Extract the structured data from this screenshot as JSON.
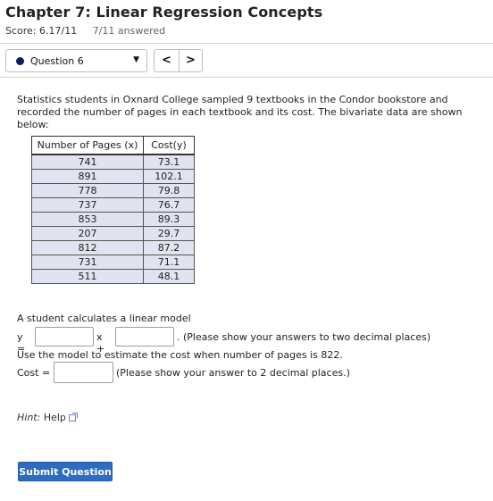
{
  "header": {
    "title": "Chapter 7: Linear Regression Concepts",
    "score": "Score: 6.17/11",
    "answered": "7/11 answered"
  },
  "question_nav": {
    "selected": "Question 6",
    "prev_label": "<",
    "next_label": ">"
  },
  "problem": {
    "text": "Statistics students in Oxnard College sampled 9 textbooks in the Condor bookstore and recorded the number of pages in each textbook and its cost. The bivariate data are shown below:",
    "table": {
      "headers": [
        "Number of Pages (x)",
        "Cost(y)"
      ],
      "rows": [
        [
          "741",
          "73.1"
        ],
        [
          "891",
          "102.1"
        ],
        [
          "778",
          "79.8"
        ],
        [
          "737",
          "76.7"
        ],
        [
          "853",
          "89.3"
        ],
        [
          "207",
          "29.7"
        ],
        [
          "812",
          "87.2"
        ],
        [
          "731",
          "71.1"
        ],
        [
          "511",
          "48.1"
        ]
      ]
    },
    "model_statement": "A student calculates a linear model",
    "y_label": "y =",
    "x_label": "x +",
    "slope_value": "",
    "intercept_value": "",
    "decimal_note": ". (Please show your answers to two decimal places)",
    "estimate_statement": "Use the model to estimate the cost when number of pages is 822.",
    "cost_label": "Cost = $",
    "cost_value": "",
    "cost_note": "(Please show your answer to 2 decimal places.)"
  },
  "hint": {
    "label": "Hint:",
    "link": "Help"
  },
  "submit_label": "Submit Question",
  "colors": {
    "table_cell_bg": "#e2e3f1",
    "submit_bg": "#2d6cc0",
    "question_dot": "#101f5c"
  }
}
